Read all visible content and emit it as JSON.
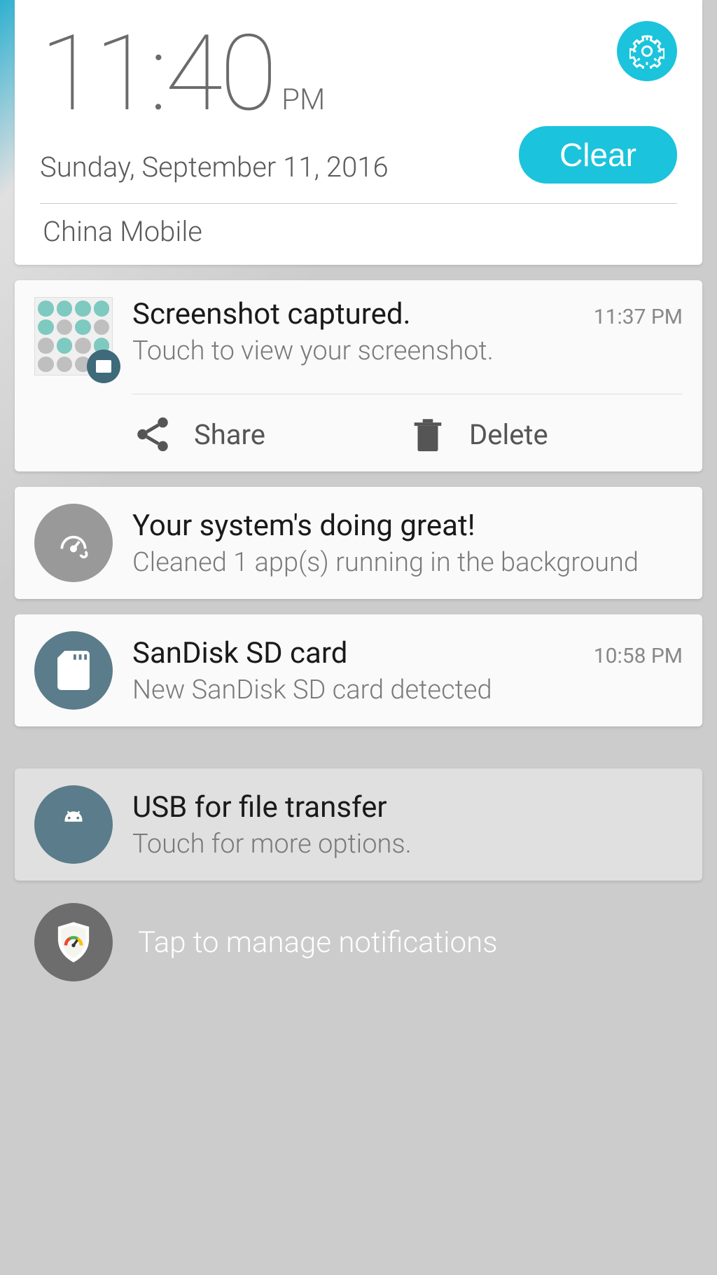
{
  "header": {
    "time": "11:40",
    "ampm": "PM",
    "date": "Sunday, September 11, 2016",
    "carrier": "China Mobile",
    "clear_label": "Clear"
  },
  "notifs": {
    "screenshot": {
      "title": "Screenshot captured.",
      "subtitle": "Touch to view your screenshot.",
      "time": "11:37 PM",
      "share_label": "Share",
      "delete_label": "Delete"
    },
    "system": {
      "title": "Your system's doing great!",
      "subtitle": "Cleaned 1 app(s) running in the background"
    },
    "sdcard": {
      "title": "SanDisk SD card",
      "subtitle": "New SanDisk SD card detected",
      "time": "10:58 PM"
    },
    "usb": {
      "title": "USB for file transfer",
      "subtitle": "Touch for more options."
    }
  },
  "manage": {
    "label": "Tap to manage notifications"
  }
}
